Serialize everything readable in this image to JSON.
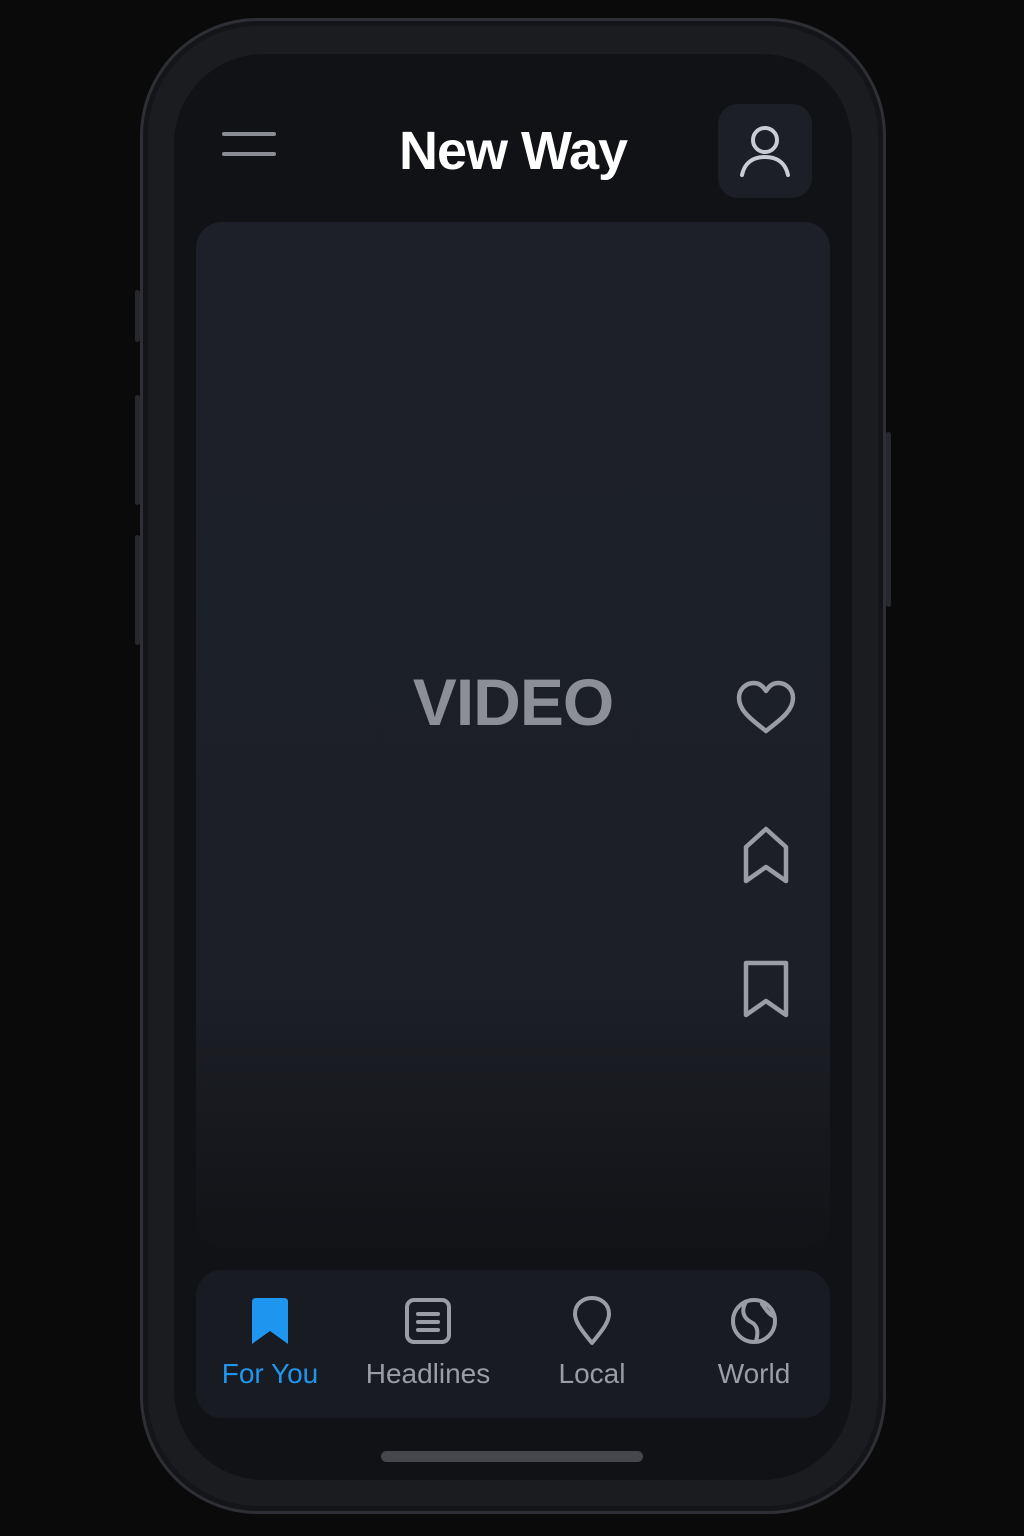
{
  "header": {
    "title": "New Way",
    "menu_icon": "hamburger-menu-icon",
    "profile_icon": "user-icon"
  },
  "video": {
    "placeholder_label": "VIDEO",
    "actions": [
      {
        "name": "like",
        "icon": "heart-icon"
      },
      {
        "name": "home",
        "icon": "home-icon"
      },
      {
        "name": "save",
        "icon": "bookmark-icon"
      }
    ]
  },
  "bottom_nav": {
    "items": [
      {
        "label": "For You",
        "icon": "bookmark-filled-icon",
        "active": true
      },
      {
        "label": "Headlines",
        "icon": "newspaper-icon",
        "active": false
      },
      {
        "label": "Local",
        "icon": "location-pin-icon",
        "active": false
      },
      {
        "label": "World",
        "icon": "globe-icon",
        "active": false
      }
    ]
  },
  "colors": {
    "background": "#0a0a0b",
    "screen": "#111215",
    "card": "#1d2028",
    "accent": "#1e96f0",
    "icon_muted": "#8a8d93",
    "text_primary": "#ffffff"
  }
}
